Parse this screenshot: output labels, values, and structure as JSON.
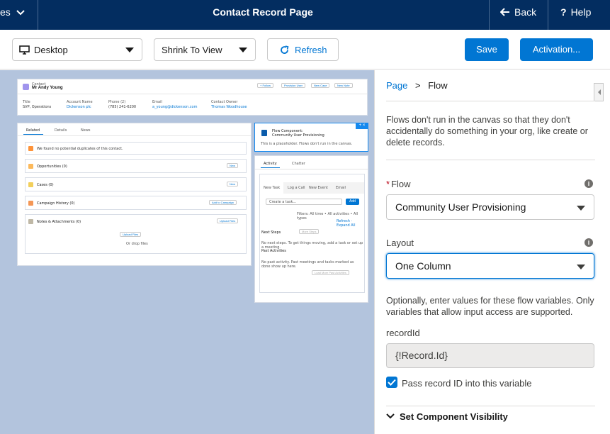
{
  "topbar": {
    "left_label": "es",
    "title": "Contact Record Page",
    "back_label": "Back",
    "help_label": "Help"
  },
  "toolbar": {
    "device_value": "Desktop",
    "zoom_value": "Shrink To View",
    "refresh_label": "Refresh",
    "save_label": "Save",
    "activation_label": "Activation..."
  },
  "canvas": {
    "header": {
      "object": "Contact",
      "name": "Mr Andy Young",
      "actions": [
        "+ Follow",
        "Provision User",
        "New Case",
        "New Note"
      ],
      "fields": [
        {
          "label": "Title",
          "value": "SVP, Operations"
        },
        {
          "label": "Account Name",
          "value": "Dickenson plc"
        },
        {
          "label": "Phone (2)",
          "value": "(785) 241-6200"
        },
        {
          "label": "Email",
          "value": "a_young@dickenson.com"
        },
        {
          "label": "Contact Owner",
          "value": "Thomas Woodhouse"
        }
      ]
    },
    "tabs": [
      "Related",
      "Details",
      "News"
    ],
    "duplicates": "We found no potential duplicates of this contact.",
    "related_lists": [
      {
        "title": "Opportunities (0)",
        "button": "New",
        "color": "#fcb95b"
      },
      {
        "title": "Cases (0)",
        "button": "New",
        "color": "#f2cf5b"
      },
      {
        "title": "Campaign History (0)",
        "button": "Add to Campaign",
        "color": "#f49756"
      },
      {
        "title": "Notes & Attachments (0)",
        "button": "Upload Files",
        "color": "#bfb8a6"
      }
    ],
    "upload_label": "Upload Files",
    "drop_label": "Or drop files",
    "flow_component": {
      "title": "Flow Component:",
      "subtitle": "Community User Provisioning",
      "note": "This is a placeholder. Flows don't run in the canvas."
    },
    "activity": {
      "tabs": [
        "Activity",
        "Chatter"
      ],
      "subtabs": [
        "New Task",
        "Log a Call",
        "New Event",
        "Email"
      ],
      "input_placeholder": "Create a task...",
      "add_label": "Add",
      "filters": "Filters: All time • All activities • All types",
      "refresh_expand": "Refresh · Expand All",
      "next_steps": "Next Steps",
      "more_steps": "More Steps",
      "next_steps_note": "No next steps. To get things moving, add a task or set up a meeting.",
      "past_activities": "Past Activities",
      "past_note": "No past activity. Past meetings and tasks marked as done show up here.",
      "load_more": "Load More Past Activities"
    }
  },
  "panel": {
    "breadcrumb_page": "Page",
    "breadcrumb_sep": ">",
    "breadcrumb_current": "Flow",
    "description": "Flows don't run in the canvas so that they don't accidentally do something in your org, like create or delete records.",
    "required_mark": "*",
    "flow_label": "Flow",
    "flow_value": "Community User Provisioning",
    "layout_label": "Layout",
    "layout_value": "One Column",
    "variables_note": "Optionally, enter values for these flow variables. Only variables that allow input access are supported.",
    "record_id_label": "recordId",
    "record_id_value": "{!Record.Id}",
    "pass_record_label": "Pass record ID into this variable",
    "pass_record_checked": true,
    "visibility_label": "Set Component Visibility"
  },
  "colors": {
    "header_bg": "#032d60",
    "brand": "#0176d3",
    "canvas_bg": "#b3c4dd"
  }
}
